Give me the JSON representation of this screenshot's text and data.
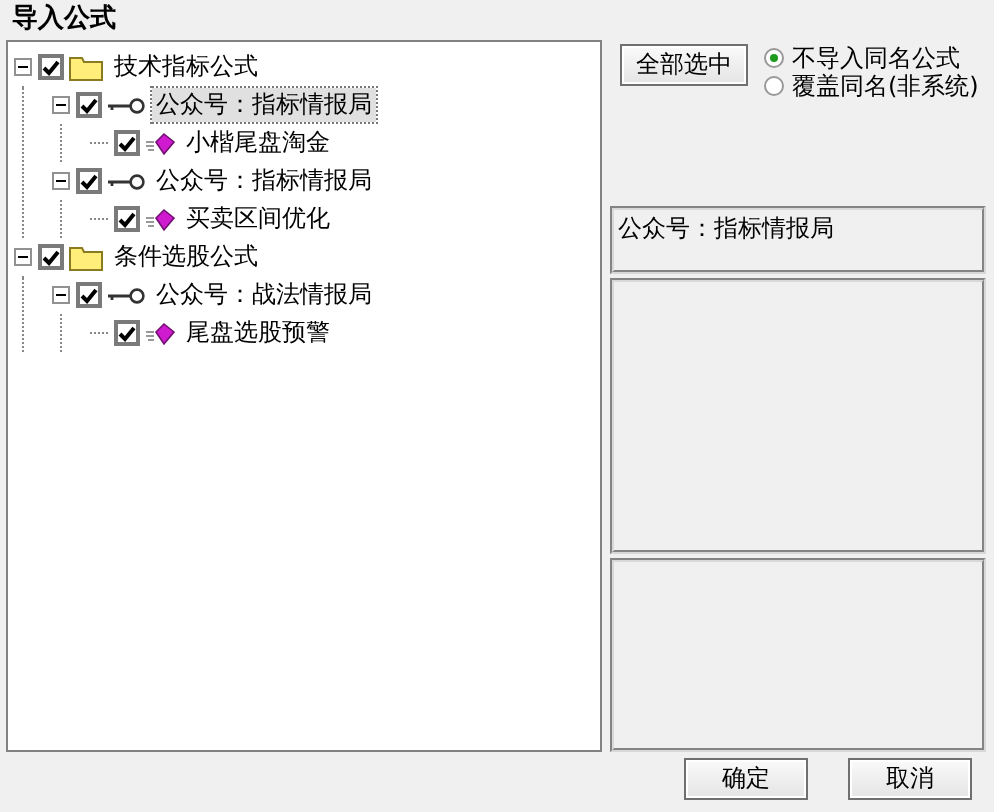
{
  "window": {
    "title": "导入公式"
  },
  "tree": [
    {
      "kind": "folder",
      "label": "技术指标公式",
      "checked": true,
      "expanded": true,
      "selected": false,
      "children": [
        {
          "kind": "group",
          "label": "公众号：指标情报局",
          "checked": true,
          "expanded": true,
          "selected": true,
          "children": [
            {
              "kind": "formula",
              "label": "小楷尾盘淘金",
              "checked": true,
              "selected": false
            }
          ]
        },
        {
          "kind": "group",
          "label": "公众号：指标情报局",
          "checked": true,
          "expanded": true,
          "selected": false,
          "children": [
            {
              "kind": "formula",
              "label": "买卖区间优化",
              "checked": true,
              "selected": false
            }
          ]
        }
      ]
    },
    {
      "kind": "folder",
      "label": "条件选股公式",
      "checked": true,
      "expanded": true,
      "selected": false,
      "children": [
        {
          "kind": "group",
          "label": "公众号：战法情报局",
          "checked": true,
          "expanded": true,
          "selected": false,
          "children": [
            {
              "kind": "formula",
              "label": "尾盘选股预警",
              "checked": true,
              "selected": false
            }
          ]
        }
      ]
    }
  ],
  "select_all_button": "全部选中",
  "options": [
    {
      "label": "不导入同名公式",
      "selected": true
    },
    {
      "label": "覆盖同名(非系统)",
      "selected": false
    }
  ],
  "info_box": "公众号：指标情报局",
  "buttons": [
    "确定",
    "取消"
  ]
}
